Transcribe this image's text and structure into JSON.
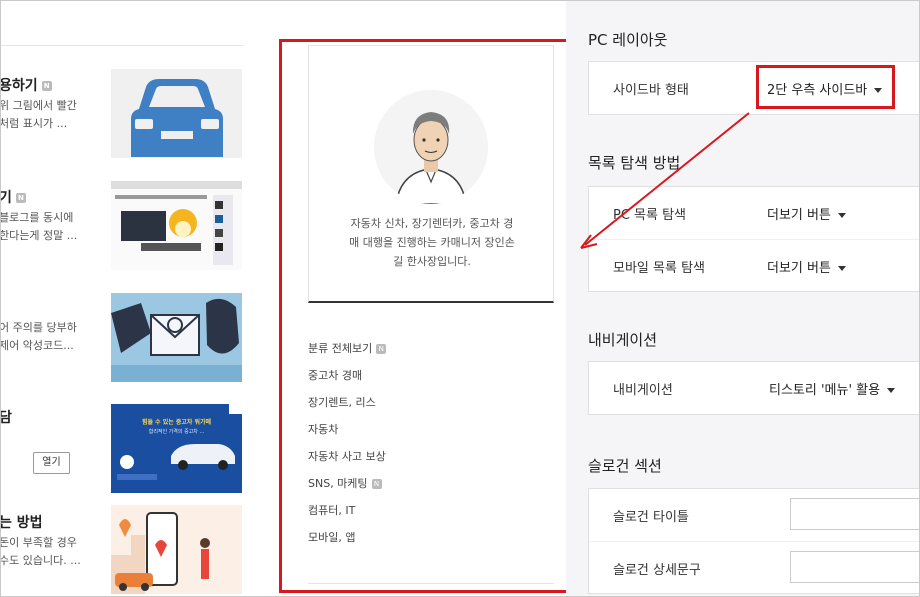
{
  "blog": {
    "posts": [
      {
        "title": "용하기",
        "has_badge": true,
        "desc": [
          "위 그림에서 빨간",
          "처럼 표시가 ..."
        ],
        "thumb": "car-icon"
      },
      {
        "title": "기",
        "has_badge": true,
        "desc": [
          "블로그를 동시에",
          "한다는게 정말 ..."
        ],
        "thumb": "screenshot-collage"
      },
      {
        "title": "",
        "has_badge": false,
        "desc": [
          "어 주의를 당부하",
          "제어 악성코드..."
        ],
        "thumb": "email-malware-illustration"
      },
      {
        "title": "담",
        "has_badge": false,
        "desc": [],
        "thumb": "used-car-ad"
      },
      {
        "title": "는 방법",
        "has_badge": false,
        "desc": [
          "돈이 부족할 경우",
          "수도 있습니다. ..."
        ],
        "thumb": "mobile-map-illustration"
      }
    ],
    "open_button": "열기",
    "ad_text": [
      "힘들 수 있는 중고차 워가메",
      "합리적인 가격의 중고차 ..."
    ]
  },
  "profile": {
    "text": [
      "자동차 신차, 장기렌터카, 중고차 경",
      "매 대행을 진행하는 카매니저 장인손",
      "길 한사장입니다."
    ]
  },
  "categories": [
    {
      "label": "분류 전체보기",
      "badge": true
    },
    {
      "label": "중고차 경매",
      "badge": false
    },
    {
      "label": "장기렌트, 리스",
      "badge": false
    },
    {
      "label": "자동차",
      "badge": false
    },
    {
      "label": "자동차 사고 보상",
      "badge": false
    },
    {
      "label": "SNS, 마케팅",
      "badge": true
    },
    {
      "label": "컴퓨터, IT",
      "badge": false
    },
    {
      "label": "모바일, 앱",
      "badge": false
    }
  ],
  "badge_letter": "N",
  "settings": {
    "pc_layout": {
      "title": "PC 레이아웃",
      "rows": [
        {
          "label": "사이드바 형태",
          "value": "2단 우측 사이드바"
        }
      ]
    },
    "list_nav": {
      "title": "목록 탐색 방법",
      "rows": [
        {
          "label": "PC 목록 탐색",
          "value": "더보기 버튼"
        },
        {
          "label": "모바일 목록 탐색",
          "value": "더보기 버튼"
        }
      ]
    },
    "navigation": {
      "title": "내비게이션",
      "rows": [
        {
          "label": "내비게이션",
          "value": "티스토리 '메뉴' 활용"
        }
      ]
    },
    "slogan": {
      "title": "슬로건 섹션",
      "rows": [
        {
          "label": "슬로건 타이틀",
          "value": ""
        },
        {
          "label": "슬로건 상세문구",
          "value": ""
        }
      ]
    }
  },
  "colors": {
    "highlight": "#d7191f",
    "panel_bg": "#f5f5f7"
  }
}
